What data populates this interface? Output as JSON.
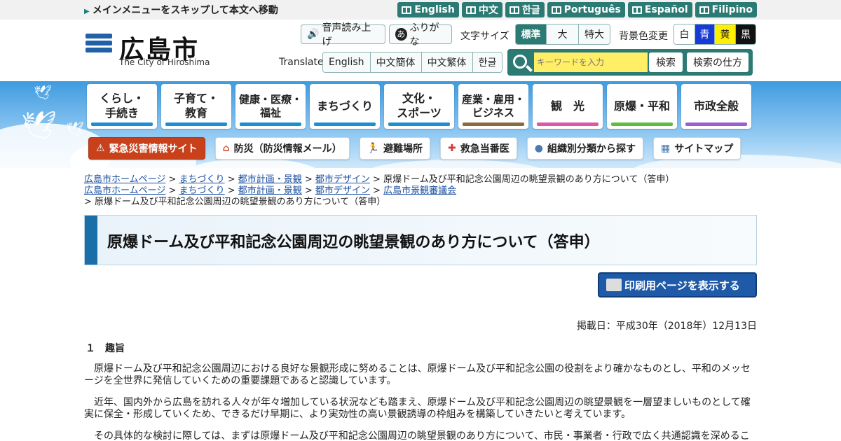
{
  "topbar": {
    "skip_link": "メインメニューをスキップして本文へ移動",
    "languages": [
      "English",
      "中文",
      "한글",
      "Português",
      "Español",
      "Filipino"
    ]
  },
  "header": {
    "logo_name": "広島市",
    "logo_sub": "The City of Hiroshima",
    "read_aloud": "音声読み上げ",
    "furigana": "ふりがな",
    "font_size_label": "文字サイズ",
    "font_sizes": [
      "標準",
      "大",
      "特大"
    ],
    "bg_color_label": "背景色変更",
    "bg_colors": [
      "白",
      "青",
      "黄",
      "黒"
    ],
    "translate_label": "Translate",
    "translate_options": [
      "English",
      "中文簡体",
      "中文繁体",
      "한글"
    ],
    "search_placeholder": "キーワードを入力",
    "search_button": "検索",
    "search_howto": "検索の仕方"
  },
  "nav": [
    {
      "label": "くらし・\n手続き",
      "color": "#1c8fd0"
    },
    {
      "label": "子育て・\n教育",
      "color": "#1c8fd0"
    },
    {
      "label": "健康・医療・\n福祉",
      "color": "#1c8fd0"
    },
    {
      "label": "まちづくり",
      "color": "#1c8fd0"
    },
    {
      "label": "文化・\nスポーツ",
      "color": "#1c8fd0"
    },
    {
      "label": "産業・雇用・\nビジネス",
      "color": "#8a6a3e"
    },
    {
      "label": "観　光",
      "color": "#e055a5"
    },
    {
      "label": "原爆・平和",
      "color": "#5bbf3d"
    },
    {
      "label": "市政全般",
      "color": "#9a5fd0"
    }
  ],
  "quicklinks": [
    "緊急災害情報サイト",
    "防災（防災情報メール）",
    "避難場所",
    "救急当番医",
    "組織別分類から探す",
    "サイトマップ"
  ],
  "breadcrumbs": {
    "row1": [
      "広島市ホームページ",
      "まちづくり",
      "都市計画・景観",
      "都市デザイン"
    ],
    "row1_current": "原爆ドーム及び平和記念公園周辺の眺望景観のあり方について（答申）",
    "row2": [
      "広島市ホームページ",
      "まちづくり",
      "都市計画・景観",
      "都市デザイン",
      "広島市景観審議会"
    ],
    "row3_current": "原爆ドーム及び平和記念公園周辺の眺望景観のあり方について（答申）"
  },
  "page_title": "原爆ドーム及び平和記念公園周辺の眺望景観のあり方について（答申）",
  "print_button": "印刷用ページを表示する",
  "published": "掲載日：平成30年（2018年）12月13日",
  "section_heading": "１　趣旨",
  "paragraphs": [
    "　原爆ドーム及び平和記念公園周辺における良好な景観形成に努めることは、原爆ドーム及び平和記念公園の役割をより確かなものとし、平和のメッセージを全世界に発信していくための重要課題であると認識しています。",
    "　近年、国内外から広島を訪れる人々が年々増加している状況なども踏まえ、原爆ドーム及び平和記念公園周辺の眺望景観を一層望ましいものとして確実に保全・形成していくため、できるだけ早期に、より実効性の高い景観誘導の枠組みを構築していきたいと考えています。",
    "　その具体的な検討に際しては、まずは原爆ドーム及び平和記念公園周辺の眺望景観のあり方について、市民・事業者・行政で広く共通認識を深めるこ"
  ]
}
